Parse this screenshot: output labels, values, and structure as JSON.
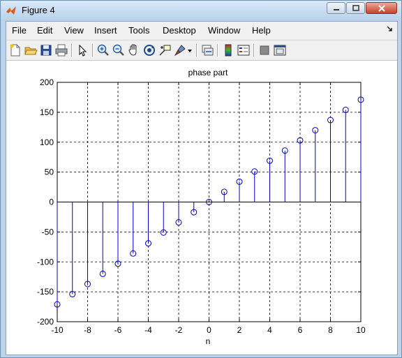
{
  "window": {
    "title": "Figure 4"
  },
  "menu": {
    "items": [
      "File",
      "Edit",
      "View",
      "Insert",
      "Tools",
      "Desktop",
      "Window",
      "Help"
    ],
    "dock_icon": "dock-arrow-icon"
  },
  "toolbar": {
    "icons": [
      "new-figure-icon",
      "open-file-icon",
      "save-icon",
      "print-icon",
      "edit-plot-arrow-icon",
      "zoom-in-icon",
      "zoom-out-icon",
      "pan-hand-icon",
      "rotate-3d-icon",
      "data-cursor-icon",
      "brush-icon",
      "brush-dropdown-icon",
      "link-plot-icon",
      "insert-colorbar-icon",
      "insert-legend-icon",
      "hide-plot-tools-icon",
      "show-plot-tools-icon"
    ]
  },
  "colors": {
    "stem": "#0000cc",
    "marker": "#0000cc",
    "grid": "#000000",
    "axes_bg": "#ffffff"
  },
  "chart_data": {
    "type": "scatter",
    "style": "stem",
    "marker": "open-circle",
    "title": "phase part",
    "xlabel": "n",
    "ylabel": "",
    "xlim": [
      -10,
      10
    ],
    "ylim": [
      -200,
      200
    ],
    "xticks": [
      -10,
      -8,
      -6,
      -4,
      -2,
      0,
      2,
      4,
      6,
      8,
      10
    ],
    "yticks": [
      200,
      150,
      100,
      50,
      0,
      -50,
      -100,
      -150,
      -200
    ],
    "grid": true,
    "x": [
      -10,
      -9,
      -8,
      -7,
      -6,
      -5,
      -4,
      -3,
      -2,
      -1,
      0,
      1,
      2,
      3,
      4,
      5,
      6,
      7,
      8,
      9,
      10
    ],
    "y": [
      -171,
      -154,
      -137,
      -120,
      -103,
      -86,
      -69,
      -51,
      -34,
      -17,
      0,
      17,
      34,
      51,
      69,
      86,
      103,
      120,
      137,
      154,
      171
    ]
  }
}
